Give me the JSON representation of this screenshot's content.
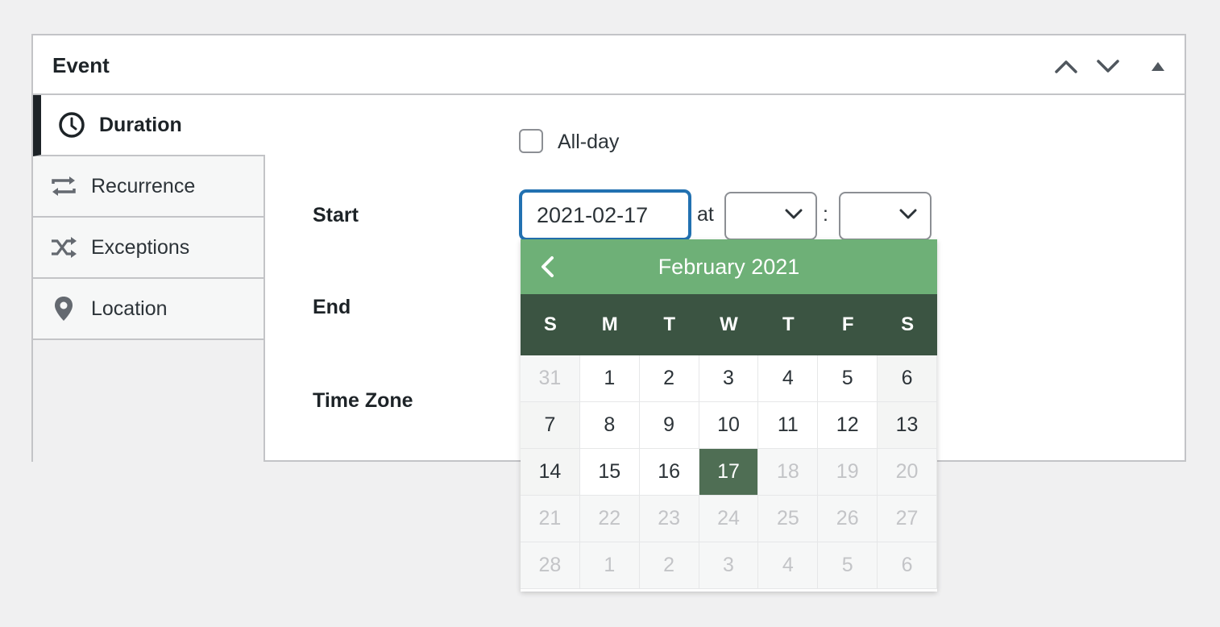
{
  "panel": {
    "title": "Event",
    "controls": [
      "chevron-up-icon",
      "chevron-down-icon",
      "triangle-up-icon"
    ]
  },
  "tabs": [
    {
      "label": "Duration",
      "icon": "clock-icon",
      "active": true
    },
    {
      "label": "Recurrence",
      "icon": "repeat-icon",
      "active": false
    },
    {
      "label": "Exceptions",
      "icon": "shuffle-icon",
      "active": false
    },
    {
      "label": "Location",
      "icon": "map-pin-icon",
      "active": false
    }
  ],
  "form": {
    "all_day_label": "All-day",
    "start_label": "Start",
    "end_label": "End",
    "timezone_label": "Time Zone",
    "start_date": "2021-02-17",
    "at_label": "at",
    "colon": ":"
  },
  "calendar": {
    "month_label": "February 2021",
    "weekdays": [
      "S",
      "M",
      "T",
      "W",
      "T",
      "F",
      "S"
    ],
    "days": [
      {
        "d": "31",
        "muted": true
      },
      {
        "d": "1"
      },
      {
        "d": "2"
      },
      {
        "d": "3"
      },
      {
        "d": "4"
      },
      {
        "d": "5"
      },
      {
        "d": "6"
      },
      {
        "d": "7"
      },
      {
        "d": "8"
      },
      {
        "d": "9"
      },
      {
        "d": "10"
      },
      {
        "d": "11"
      },
      {
        "d": "12"
      },
      {
        "d": "13"
      },
      {
        "d": "14"
      },
      {
        "d": "15"
      },
      {
        "d": "16"
      },
      {
        "d": "17",
        "selected": true
      },
      {
        "d": "18",
        "muted": true
      },
      {
        "d": "19",
        "muted": true
      },
      {
        "d": "20",
        "muted": true
      },
      {
        "d": "21",
        "muted": true
      },
      {
        "d": "22",
        "muted": true
      },
      {
        "d": "23",
        "muted": true
      },
      {
        "d": "24",
        "muted": true
      },
      {
        "d": "25",
        "muted": true
      },
      {
        "d": "26",
        "muted": true
      },
      {
        "d": "27",
        "muted": true
      },
      {
        "d": "28",
        "muted": true
      },
      {
        "d": "1",
        "muted": true
      },
      {
        "d": "2",
        "muted": true
      },
      {
        "d": "3",
        "muted": true
      },
      {
        "d": "4",
        "muted": true
      },
      {
        "d": "5",
        "muted": true
      },
      {
        "d": "6",
        "muted": true
      }
    ],
    "colors": {
      "header": "#6eb077",
      "weekday_bar": "#3b5442",
      "selected": "#4f6e54"
    }
  }
}
